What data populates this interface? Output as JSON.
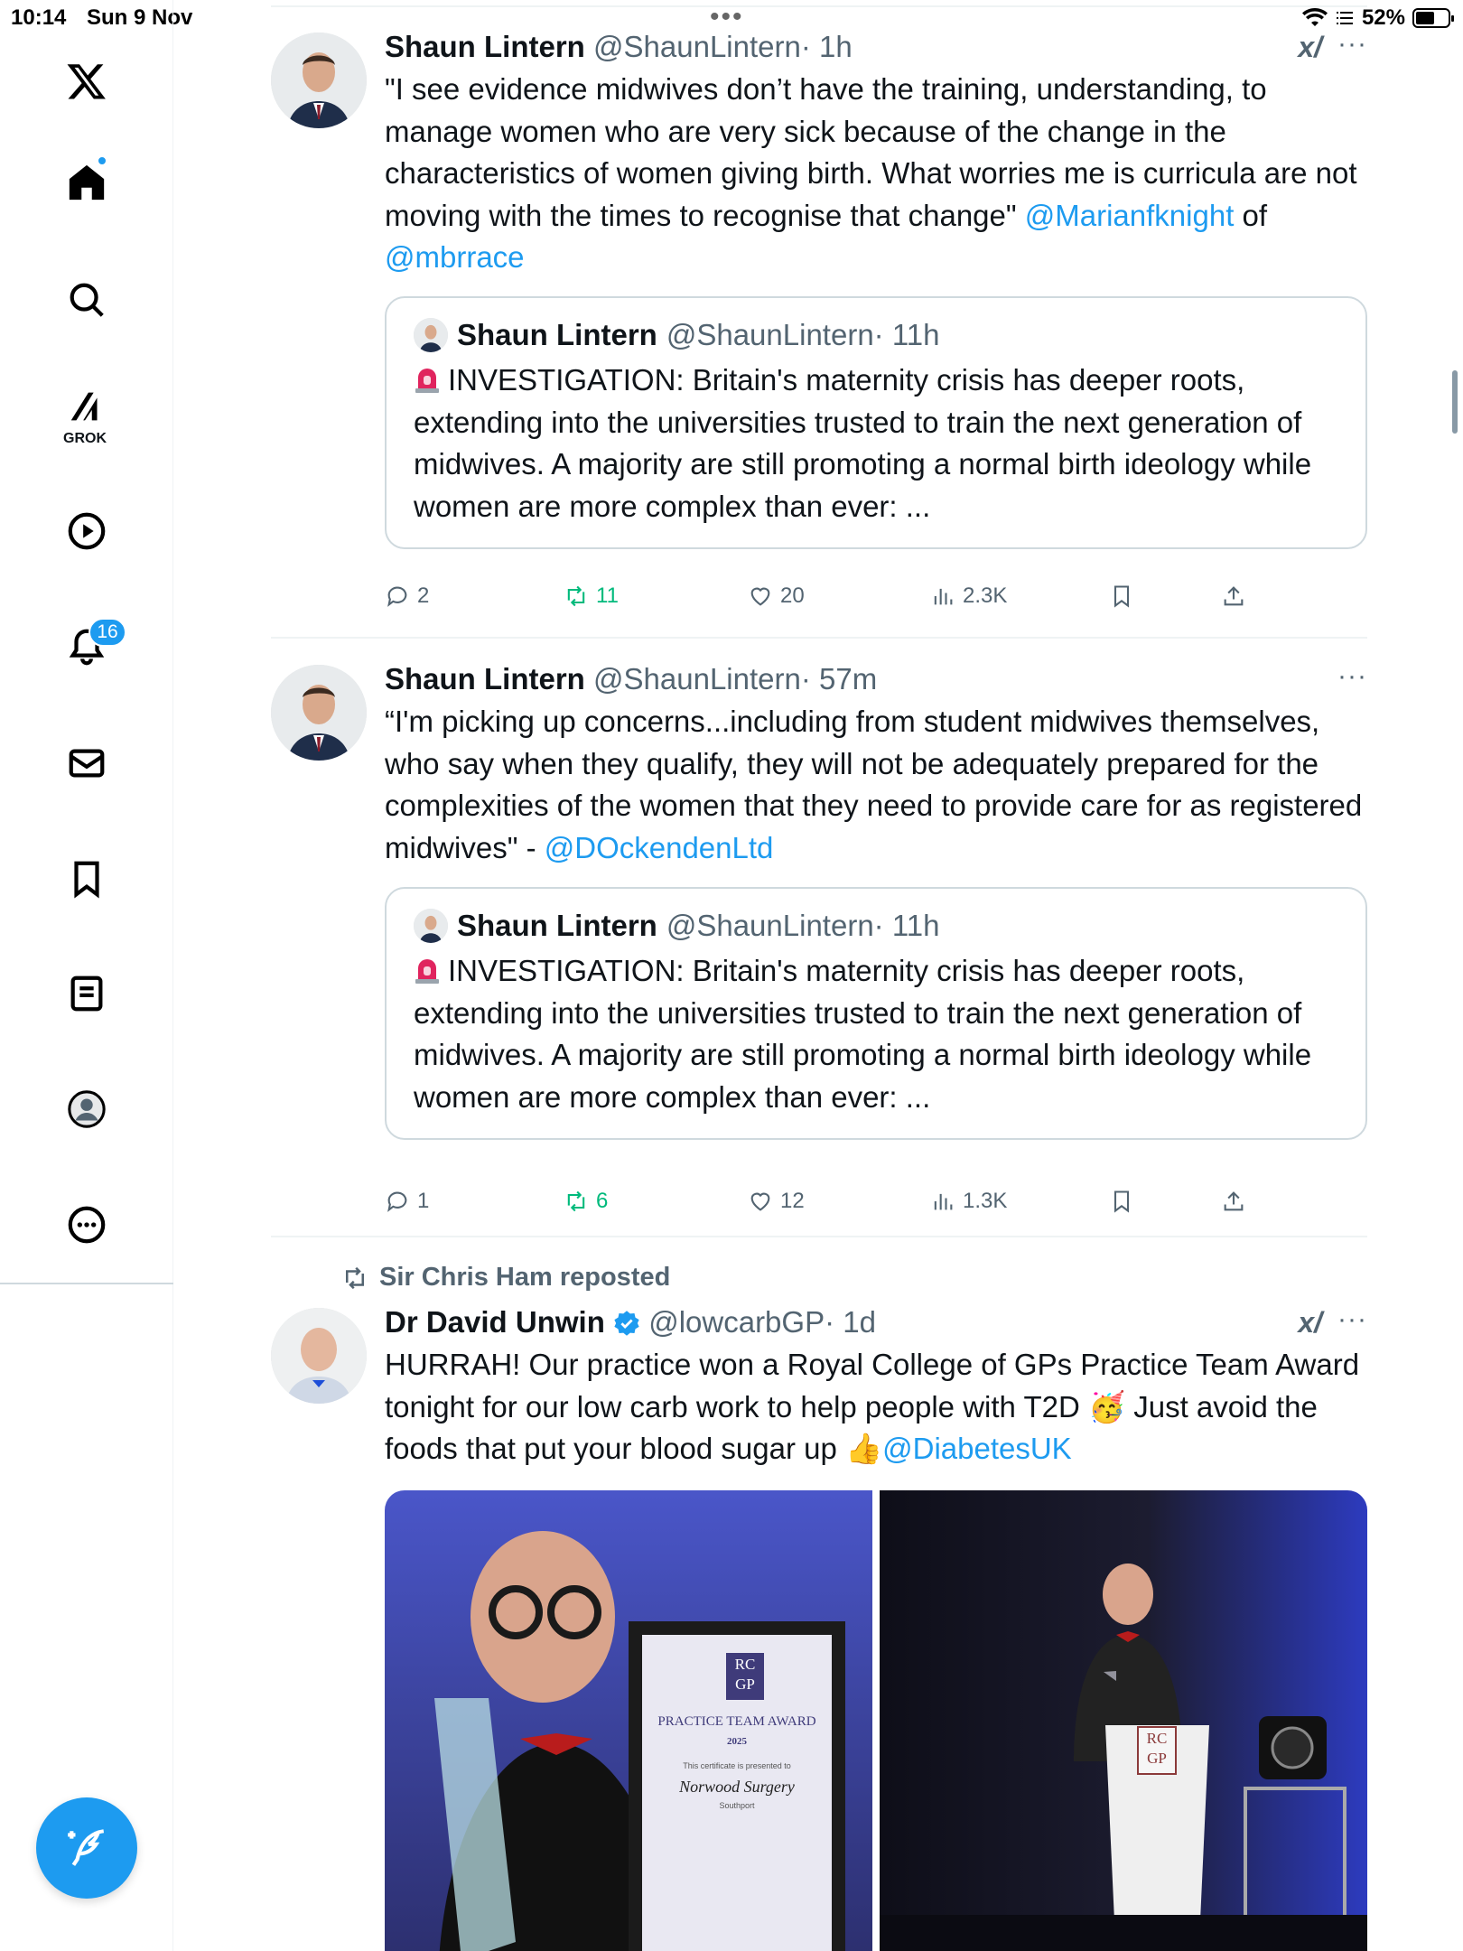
{
  "status": {
    "time": "10:14",
    "date": "Sun 9 Nov",
    "battery": "52%"
  },
  "sidebar": {
    "logo": "x-logo-icon",
    "items": [
      {
        "icon": "home-icon",
        "label": ""
      },
      {
        "icon": "search-icon",
        "label": ""
      },
      {
        "icon": "grok-icon",
        "label": "GROK"
      },
      {
        "icon": "video-play-icon",
        "label": ""
      },
      {
        "icon": "bell-icon",
        "label": ""
      },
      {
        "icon": "mail-icon",
        "label": ""
      },
      {
        "icon": "bookmark-icon",
        "label": ""
      },
      {
        "icon": "list-icon",
        "label": ""
      },
      {
        "icon": "profile-icon",
        "label": ""
      },
      {
        "icon": "more-circle-icon",
        "label": ""
      }
    ],
    "notifications_count": "16"
  },
  "tweets": [
    {
      "name": "Shaun Lintern",
      "handle": "@ShaunLintern",
      "time": "· 1h",
      "text_main": "\"I see evidence midwives don’t have the training, understanding, to manage women who are very sick because of the change in the characteristics of women giving birth. What worries me is curricula are not moving with the times to recognise that change\" ",
      "mention_1": "@Marianfknight",
      "text_mid": " of",
      "mention_2": "@mbrrace",
      "quote": {
        "name": "Shaun Lintern",
        "handle": "@ShaunLintern",
        "time": "· 11h",
        "text": "INVESTIGATION: Britain's maternity crisis has deeper roots, extending into the universities trusted to train the next generation of midwives. A majority are still promoting a normal birth ideology while women are more complex than ever: ..."
      },
      "replies": "2",
      "reposts": "11",
      "likes": "20",
      "views": "2.3K"
    },
    {
      "name": "Shaun Lintern",
      "handle": "@ShaunLintern",
      "time": "· 57m",
      "text_main": "“I'm picking up concerns...including from student midwives themselves, who say when they qualify, they will not be adequately prepared for the complexities of the women that they need to provide care for as registered midwives\" - ",
      "mention_1": "@DOckendenLtd",
      "quote": {
        "name": "Shaun Lintern",
        "handle": "@ShaunLintern",
        "time": "· 11h",
        "text": "INVESTIGATION: Britain's maternity crisis has deeper roots, extending into the universities trusted to train the next generation of midwives. A majority are still promoting a normal birth ideology while women are more complex than ever: ..."
      },
      "replies": "1",
      "reposts": "6",
      "likes": "12",
      "views": "1.3K"
    },
    {
      "reposted_by": "Sir Chris Ham reposted",
      "name": "Dr David Unwin",
      "handle": "@lowcarbGP",
      "time": "· 1d",
      "text_main": "HURRAH! Our practice won a Royal College of GPs Practice Team Award tonight for our low carb work to help people with T2D 🥳 Just avoid the foods that put your blood sugar up 👍",
      "mention_1": "@DiabetesUK",
      "photo_1": {
        "title": "PRACTICE TEAM AWARD",
        "year": "2025",
        "presented": "This certificate is presented to",
        "recipient": "Norwood Surgery",
        "place": "Southport",
        "logo": "RC GP"
      },
      "photo_2": {
        "logo": "RC GP"
      }
    }
  ],
  "colors": {
    "accent": "#1d9bf0",
    "repost": "#00ba7c",
    "muted": "#536471"
  }
}
